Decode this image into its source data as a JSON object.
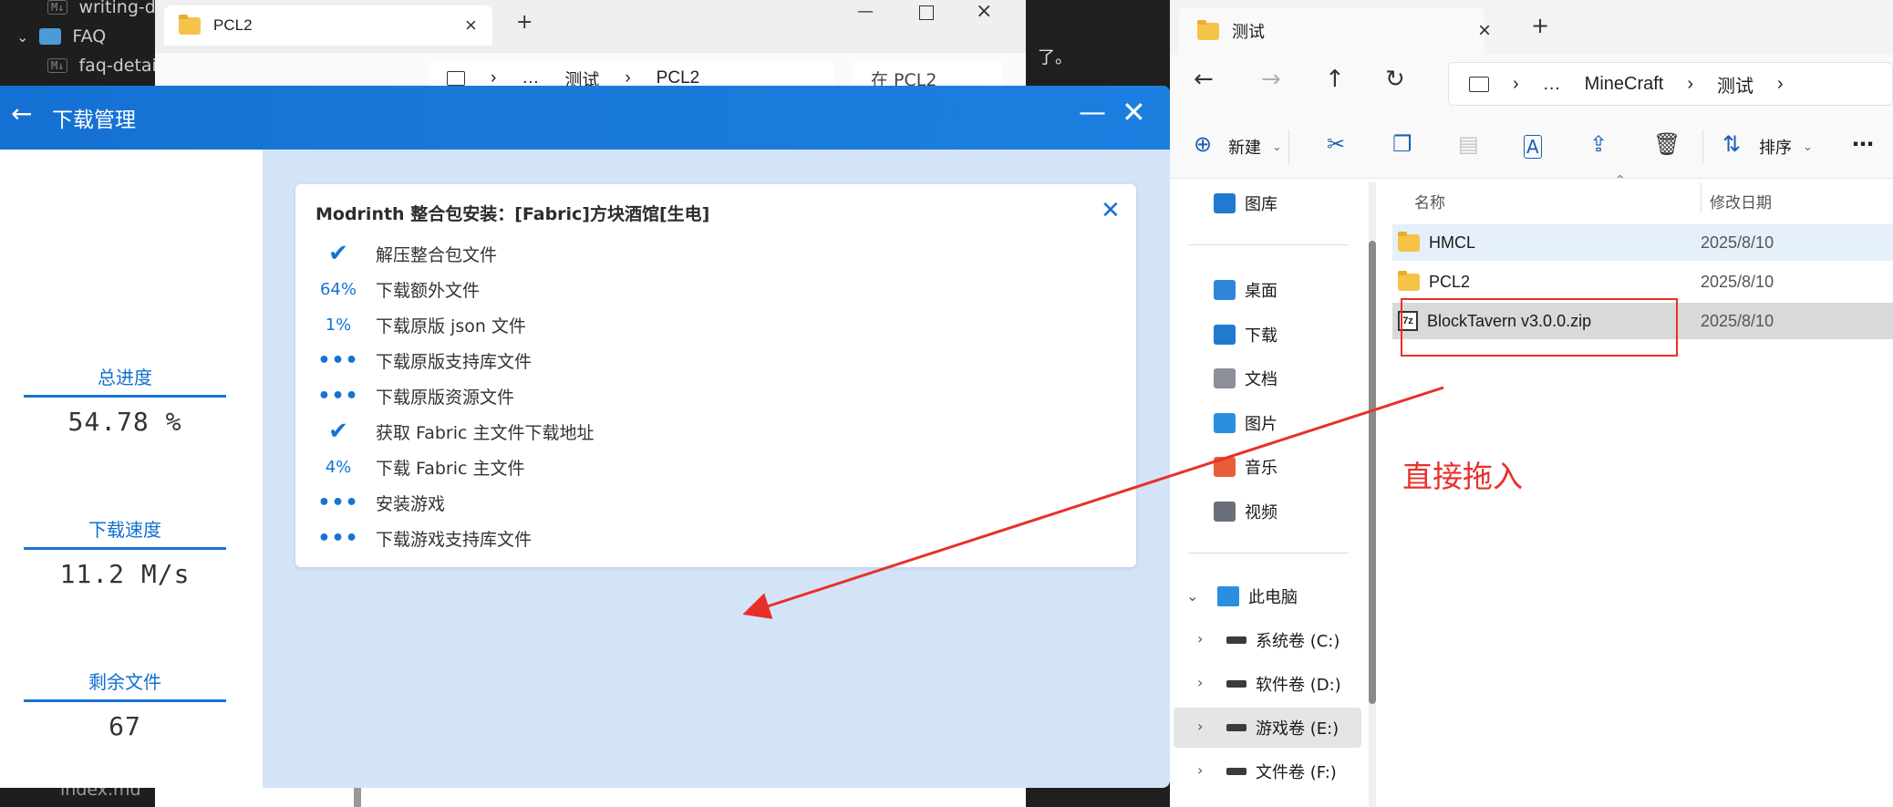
{
  "editor": {
    "items": [
      {
        "badge": "M↓",
        "label": "writing-d"
      },
      {
        "chevron": "⌄",
        "label": "FAQ"
      },
      {
        "badge": "M↓",
        "label": "faq-detai"
      },
      {
        "badge": "",
        "label": "index.md"
      }
    ]
  },
  "bg_explorer": {
    "tab_title": "PCL2",
    "address": [
      "…",
      "测试",
      "PCL2"
    ],
    "search_placeholder": "在 PCL2",
    "partial_text": "了。"
  },
  "pcl": {
    "title": "下载管理",
    "stats": [
      {
        "label": "总进度",
        "value": "54.78 %"
      },
      {
        "label": "下载速度",
        "value": "11.2 M/s"
      },
      {
        "label": "剩余文件",
        "value": "67"
      }
    ],
    "card": {
      "title": "Modrinth 整合包安装：[Fabric]方块酒馆[生电]",
      "tasks": [
        {
          "status": "✔",
          "kind": "check",
          "label": "解压整合包文件"
        },
        {
          "status": "64%",
          "kind": "pct",
          "label": "下载额外文件"
        },
        {
          "status": "1%",
          "kind": "pct",
          "label": "下载原版 json 文件"
        },
        {
          "status": "•••",
          "kind": "dots",
          "label": "下载原版支持库文件"
        },
        {
          "status": "•••",
          "kind": "dots",
          "label": "下载原版资源文件"
        },
        {
          "status": "✔",
          "kind": "check",
          "label": "获取 Fabric 主文件下载地址"
        },
        {
          "status": "4%",
          "kind": "pct",
          "label": "下载 Fabric 主文件"
        },
        {
          "status": "•••",
          "kind": "dots",
          "label": "安装游戏"
        },
        {
          "status": "•••",
          "kind": "dots",
          "label": "下载游戏支持库文件"
        }
      ]
    }
  },
  "fg_explorer": {
    "tab_title": "测试",
    "address": [
      "…",
      "MineCraft",
      "测试"
    ],
    "toolbar": {
      "new_label": "新建",
      "sort_label": "排序"
    },
    "nav_pane": {
      "gallery": "图库",
      "quick": [
        {
          "label": "桌面",
          "color": "#2f86d9"
        },
        {
          "label": "下载",
          "color": "#1f7ad0"
        },
        {
          "label": "文档",
          "color": "#8a8f99"
        },
        {
          "label": "图片",
          "color": "#2a8fe0"
        },
        {
          "label": "音乐",
          "color": "#e85d3a"
        },
        {
          "label": "视频",
          "color": "#6a6f7a"
        }
      ],
      "this_pc": "此电脑",
      "drives": [
        "系统卷 (C:)",
        "软件卷 (D:)",
        "游戏卷 (E:)",
        "文件卷 (F:)"
      ]
    },
    "columns": {
      "name": "名称",
      "date": "修改日期"
    },
    "files": [
      {
        "name": "HMCL",
        "type": "folder",
        "date": "2025/8/10"
      },
      {
        "name": "PCL2",
        "type": "folder",
        "date": "2025/8/10"
      },
      {
        "name": "BlockTavern v3.0.0.zip",
        "type": "zip",
        "date": "2025/8/10"
      }
    ]
  },
  "annotation": {
    "text": "直接拖入",
    "color": "#e8302a"
  }
}
